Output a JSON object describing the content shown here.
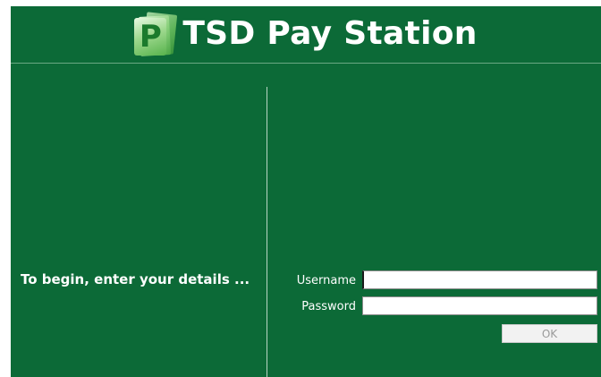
{
  "header": {
    "logo_letter": "P",
    "title": "TSD Pay Station"
  },
  "login": {
    "prompt": "To begin, enter your details ...",
    "username_label": "Username",
    "username_value": "",
    "password_label": "Password",
    "password_value": "",
    "ok_label": "OK"
  },
  "colors": {
    "background": "#0c6a37",
    "text": "#ffffff",
    "button_disabled_text": "#9a9a9a"
  },
  "icons": {
    "logo": "pay-station-logo-icon"
  }
}
